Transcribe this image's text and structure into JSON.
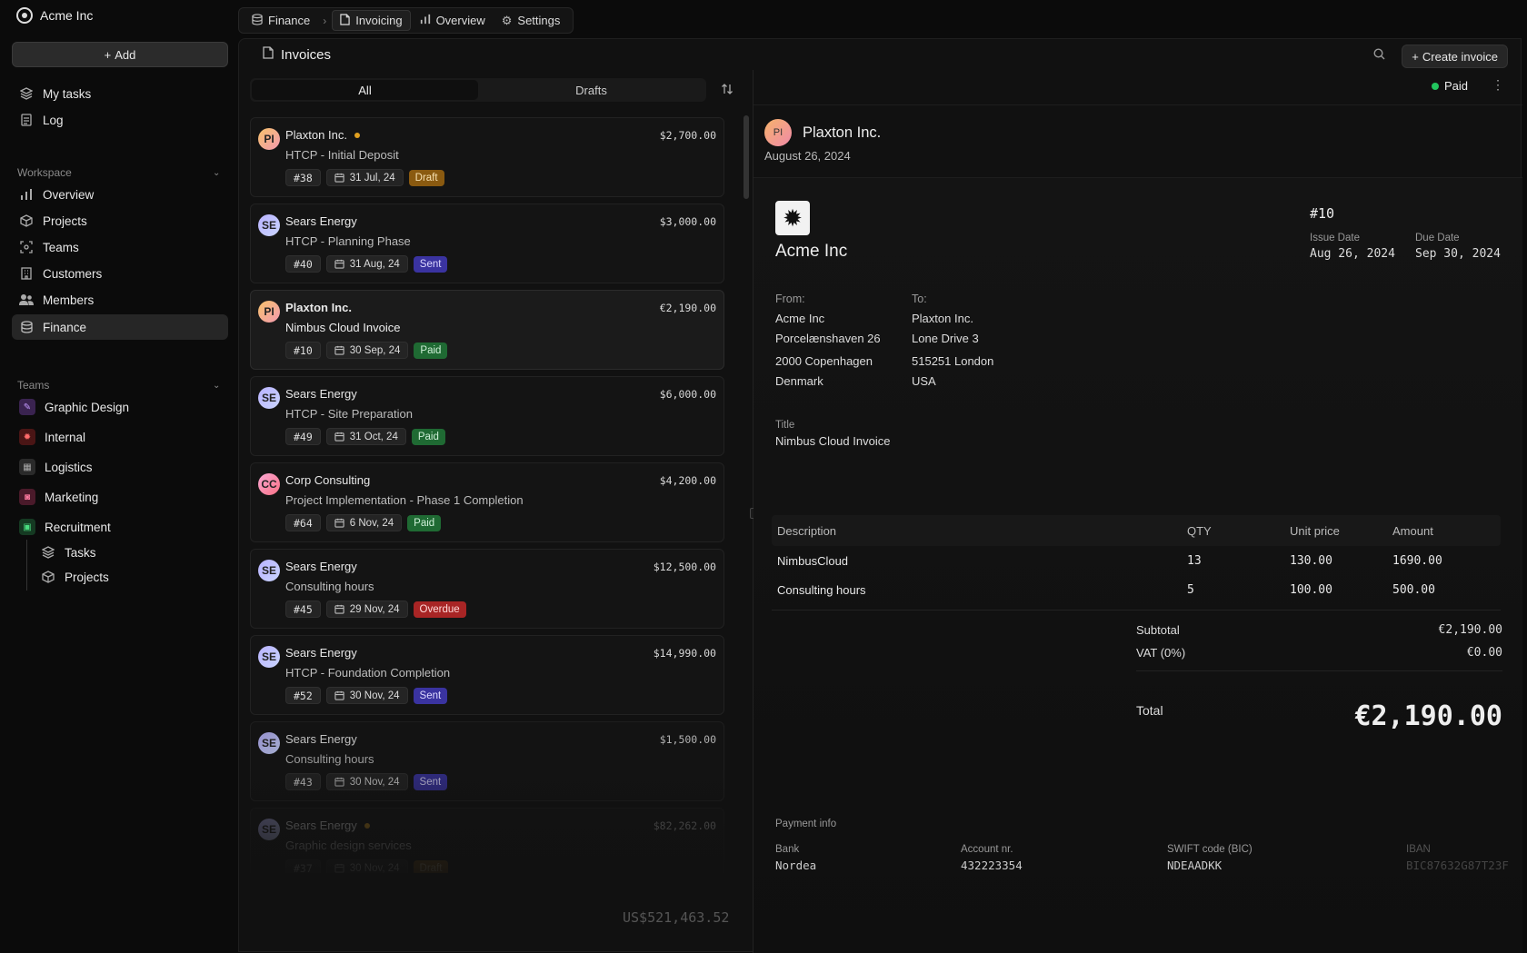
{
  "app": {
    "org": "Acme Inc",
    "add_label": "Add"
  },
  "nav_top": [
    {
      "label": "My tasks",
      "icon": "stack-icon"
    },
    {
      "label": "Log",
      "icon": "document-icon"
    }
  ],
  "workspace": {
    "label": "Workspace",
    "items": [
      {
        "label": "Overview",
        "icon": "bar-chart-icon"
      },
      {
        "label": "Projects",
        "icon": "cube-icon"
      },
      {
        "label": "Teams",
        "icon": "focus-icon"
      },
      {
        "label": "Customers",
        "icon": "building-icon"
      },
      {
        "label": "Members",
        "icon": "users-icon"
      },
      {
        "label": "Finance",
        "icon": "database-icon"
      }
    ]
  },
  "teams": {
    "label": "Teams",
    "items": [
      {
        "label": "Graphic Design",
        "color": "#6b3fa0"
      },
      {
        "label": "Internal",
        "color": "#8a1f1f"
      },
      {
        "label": "Logistics",
        "color": "#3a3a3a"
      },
      {
        "label": "Marketing",
        "color": "#9a2a4a"
      },
      {
        "label": "Recruitment",
        "color": "#1f6a3a"
      }
    ],
    "sub_items": [
      {
        "label": "Tasks",
        "icon": "stack-icon"
      },
      {
        "label": "Projects",
        "icon": "cube-icon"
      }
    ]
  },
  "topbar": {
    "root": "Finance",
    "tabs": [
      "Invoicing",
      "Overview",
      "Settings"
    ]
  },
  "page": {
    "title": "Invoices",
    "create_label": "Create invoice",
    "tabs": [
      "All",
      "Drafts"
    ]
  },
  "invoices": [
    {
      "initials": "PI",
      "client": "Plaxton Inc.",
      "dot": true,
      "desc": "HTCP - Initial Deposit",
      "amount": "$2,700.00",
      "number": "#38",
      "date": "31 Jul, 24",
      "status": "Draft"
    },
    {
      "initials": "SE",
      "client": "Sears Energy",
      "dot": false,
      "desc": "HTCP - Planning Phase",
      "amount": "$3,000.00",
      "number": "#40",
      "date": "31 Aug, 24",
      "status": "Sent"
    },
    {
      "initials": "PI",
      "client": "Plaxton Inc.",
      "dot": false,
      "desc": "Nimbus Cloud Invoice",
      "amount": "€2,190.00",
      "number": "#10",
      "date": "30 Sep, 24",
      "status": "Paid"
    },
    {
      "initials": "SE",
      "client": "Sears Energy",
      "dot": false,
      "desc": "HTCP - Site Preparation",
      "amount": "$6,000.00",
      "number": "#49",
      "date": "31 Oct, 24",
      "status": "Paid"
    },
    {
      "initials": "CC",
      "client": "Corp Consulting",
      "dot": false,
      "desc": "Project Implementation - Phase 1 Completion",
      "amount": "$4,200.00",
      "number": "#64",
      "date": "6 Nov, 24",
      "status": "Paid"
    },
    {
      "initials": "SE",
      "client": "Sears Energy",
      "dot": false,
      "desc": "Consulting hours",
      "amount": "$12,500.00",
      "number": "#45",
      "date": "29 Nov, 24",
      "status": "Overdue"
    },
    {
      "initials": "SE",
      "client": "Sears Energy",
      "dot": false,
      "desc": "HTCP - Foundation Completion",
      "amount": "$14,990.00",
      "number": "#52",
      "date": "30 Nov, 24",
      "status": "Sent"
    },
    {
      "initials": "SE",
      "client": "Sears Energy",
      "dot": false,
      "desc": "Consulting hours",
      "amount": "$1,500.00",
      "number": "#43",
      "date": "30 Nov, 24",
      "status": "Sent"
    },
    {
      "initials": "SE",
      "client": "Sears Energy",
      "dot": true,
      "desc": "Graphic design services",
      "amount": "$82,262.00",
      "number": "#37",
      "date": "30 Nov, 24",
      "status": "Draft"
    }
  ],
  "list_total": "US$521,463.52",
  "detail": {
    "status": "Paid",
    "initials": "PI",
    "client": "Plaxton Inc.",
    "date": "August 26, 2024",
    "company": "Acme Inc",
    "number": "#10",
    "issue_label": "Issue Date",
    "issue_date": "Aug 26, 2024",
    "due_label": "Due Date",
    "due_date": "Sep 30, 2024",
    "from_label": "From:",
    "from": [
      "Acme Inc",
      "Porcelænshaven 26",
      "2000 Copenhagen",
      "Denmark"
    ],
    "to_label": "To:",
    "to": [
      "Plaxton Inc.",
      "Lone Drive 3",
      "515251 London",
      "USA"
    ],
    "title_label": "Title",
    "title": "Nimbus Cloud Invoice",
    "columns": [
      "Description",
      "QTY",
      "Unit price",
      "Amount"
    ],
    "lines": [
      {
        "desc": "NimbusCloud",
        "qty": "13",
        "unit": "130.00",
        "amount": "1690.00"
      },
      {
        "desc": "Consulting hours",
        "qty": "5",
        "unit": "100.00",
        "amount": "500.00"
      }
    ],
    "subtotal_label": "Subtotal",
    "subtotal": "€2,190.00",
    "vat_label": "VAT (0%)",
    "vat": "€0.00",
    "total_label": "Total",
    "total": "€2,190.00",
    "payment_label": "Payment info",
    "bank_label": "Bank",
    "bank": "Nordea",
    "account_label": "Account nr.",
    "account": "432223354",
    "swift_label": "SWIFT code (BIC)",
    "swift": "NDEAADKK",
    "iban_label": "IBAN",
    "iban": "BIC87632G87T23F"
  }
}
